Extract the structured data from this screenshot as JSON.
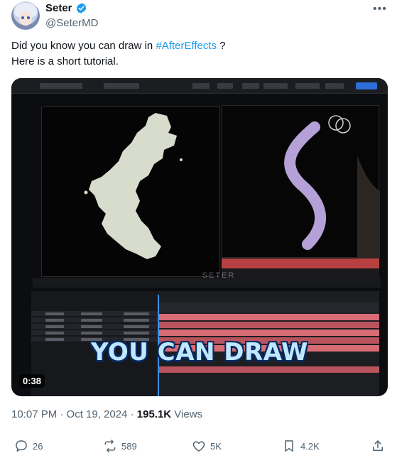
{
  "author": {
    "name": "Seter",
    "handle": "@SeterMD",
    "verified": true
  },
  "tweet": {
    "text_before_tag": "Did you know you can draw in ",
    "hashtag": "#AfterEffects",
    "text_after_tag": " ?",
    "line2": "Here is a short tutorial."
  },
  "video": {
    "overlay_text": "YOU CAN DRAW",
    "watermark": "SETER",
    "duration": "0:38"
  },
  "meta": {
    "timestamp": "10:07 PM · Oct 19, 2024 · ",
    "views_count": "195.1K",
    "views_label": " Views"
  },
  "actions": {
    "replies": "26",
    "reposts": "589",
    "likes": "5K",
    "bookmarks": "4.2K"
  },
  "colors": {
    "accent": "#1d9bf0",
    "text": "#0f1419",
    "muted": "#536471"
  },
  "icons": [
    "verified-badge-icon",
    "more-icon",
    "reply-icon",
    "repost-icon",
    "like-icon",
    "bookmark-icon",
    "share-icon"
  ]
}
